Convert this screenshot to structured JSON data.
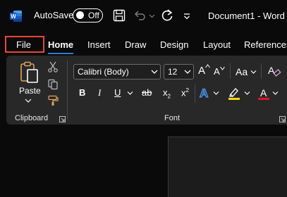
{
  "titlebar": {
    "app_icon": "word-logo-icon",
    "autosave_label": "AutoSave",
    "autosave_state": "Off",
    "document_title": "Document1  -  Word"
  },
  "tabs": [
    {
      "label": "File",
      "highlighted": true
    },
    {
      "label": "Home",
      "active": true
    },
    {
      "label": "Insert"
    },
    {
      "label": "Draw"
    },
    {
      "label": "Design"
    },
    {
      "label": "Layout"
    },
    {
      "label": "References"
    }
  ],
  "clipboard": {
    "paste_label": "Paste",
    "group_label": "Clipboard"
  },
  "font": {
    "font_name": "Calibri (Body)",
    "font_size": "12",
    "group_label": "Font",
    "bold": "B",
    "italic": "I",
    "underline": "U",
    "strikethrough": "ab",
    "subscript": "x",
    "subscript_mark": "2",
    "superscript": "x",
    "superscript_mark": "2",
    "grow": "A",
    "shrink": "A",
    "change_case": "Aa",
    "highlight_color": "#f5d60a",
    "font_color": "#e81123",
    "text_effects_color": "#4a9eff"
  },
  "colors": {
    "accent": "#2b7cd3",
    "file_highlight": "#e8463b"
  }
}
